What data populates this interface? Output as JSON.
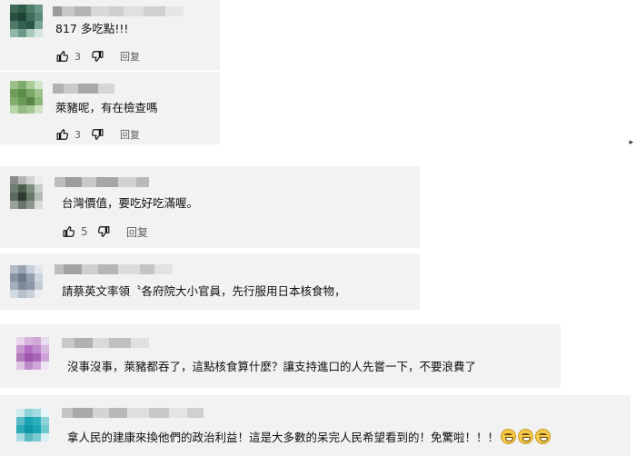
{
  "comments": [
    {
      "text": "817 多吃點!!!",
      "likes": "3",
      "reply_label": "回复"
    },
    {
      "text": "萊豬呢，有在檢查嗎",
      "likes": "3",
      "reply_label": "回复"
    },
    {
      "text": "台灣價值，要吃好吃滿喔。",
      "likes": "5",
      "reply_label": "回复"
    },
    {
      "text": "請蔡英文率領〝各府院大小官員，先行服用日本核食物，"
    },
    {
      "text": "沒事沒事，萊豬都吞了，這點核食算什麼？讓支持進口的人先嘗一下，不要浪費了"
    },
    {
      "text": "拿人民的建康來換他們的政治利益！這是大多數的呆完人民希望看到的！免驚啦！！！"
    }
  ],
  "icons": {
    "like": "thumb-up-icon",
    "dislike": "thumb-down-icon",
    "emoji": "grinning-face-icon"
  },
  "colors": {
    "card_bg": "#f2f2f2",
    "text": "#0f0f0f",
    "meta": "#606060"
  }
}
